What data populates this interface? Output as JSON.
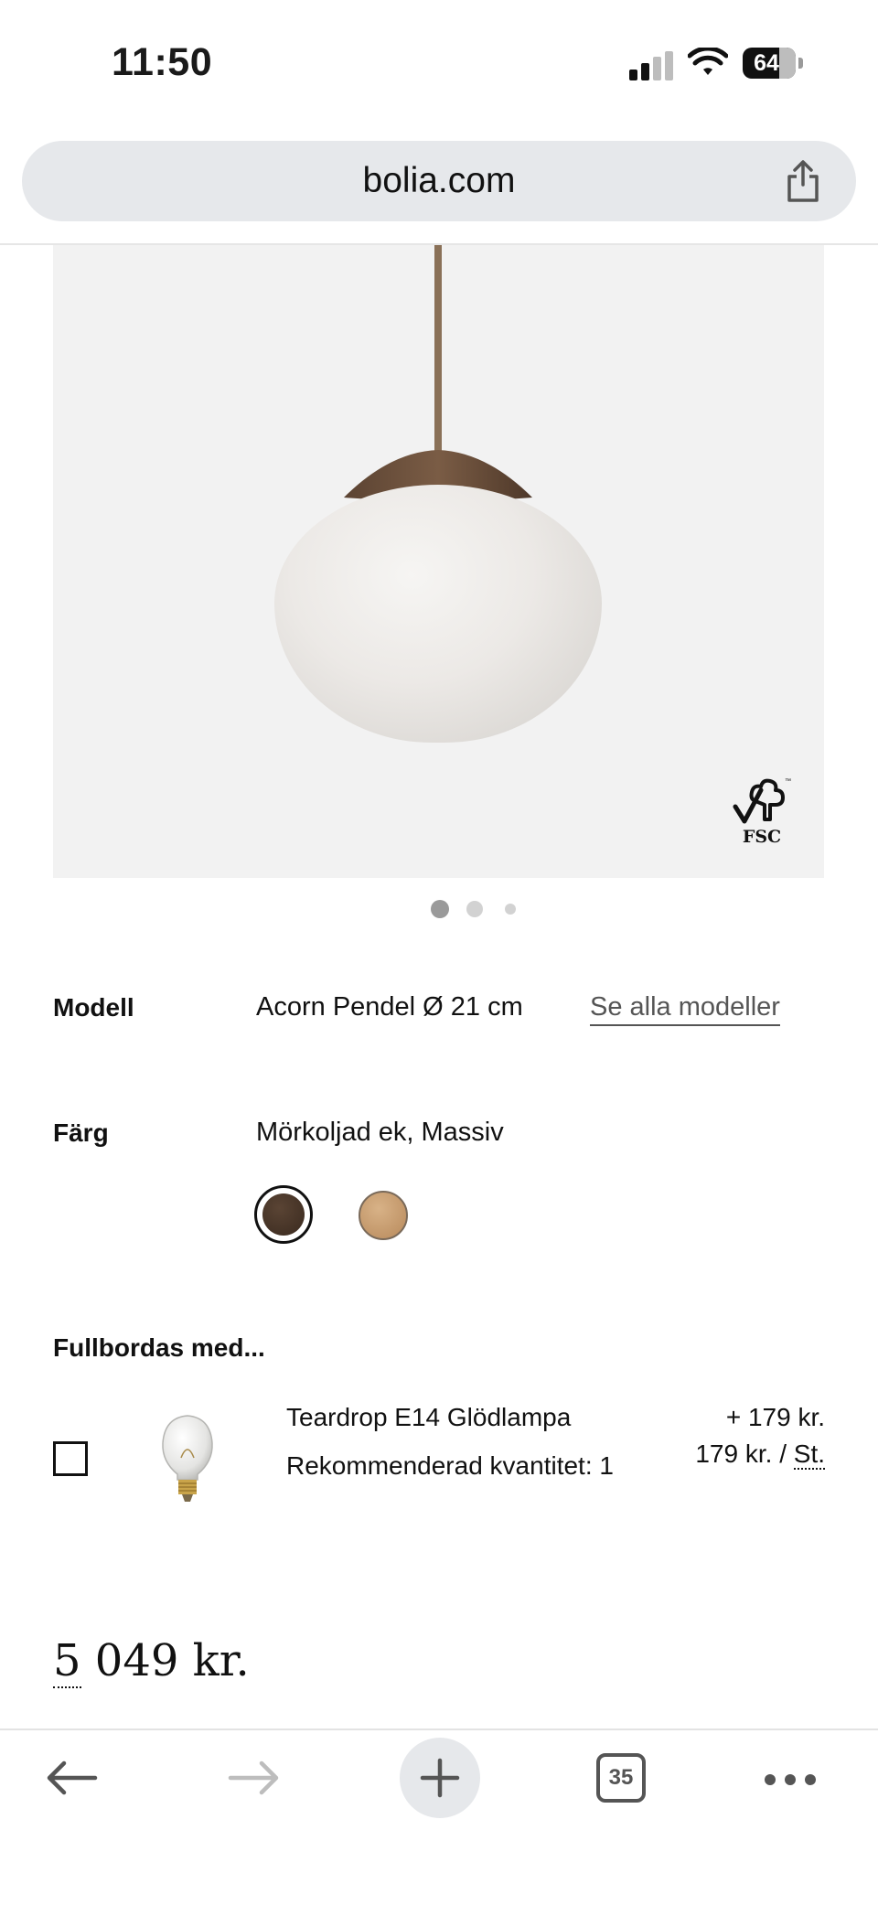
{
  "status_bar": {
    "time": "11:50",
    "battery_level": "64"
  },
  "browser": {
    "url": "bolia.com"
  },
  "gallery": {
    "logo_text": "FSC",
    "dots_count": 3,
    "active_dot": 1
  },
  "product": {
    "model_label": "Modell",
    "model_value": "Acorn Pendel Ø 21 cm",
    "all_models_link": "Se alla modeller",
    "color_label": "Färg",
    "color_value": "Mörkoljad ek, Massiv",
    "swatches": [
      {
        "name": "Mörkoljad ek",
        "color": "#3f2e22",
        "selected": true
      },
      {
        "name": "Ek",
        "color": "#c99d6e",
        "selected": false
      }
    ]
  },
  "addons": {
    "heading": "Fullbordas med...",
    "items": [
      {
        "name": "Teardrop E14 Glödlampa",
        "recommended": "Rekommenderad kvantitet: 1",
        "price_add": "+ 179 kr.",
        "unit_price": "179 kr. /",
        "unit_abbr": "St.",
        "checked": false
      }
    ]
  },
  "price": {
    "total_first": "5",
    "total_rest": " 049 kr."
  },
  "bottom_nav": {
    "tabs_count": "35"
  }
}
